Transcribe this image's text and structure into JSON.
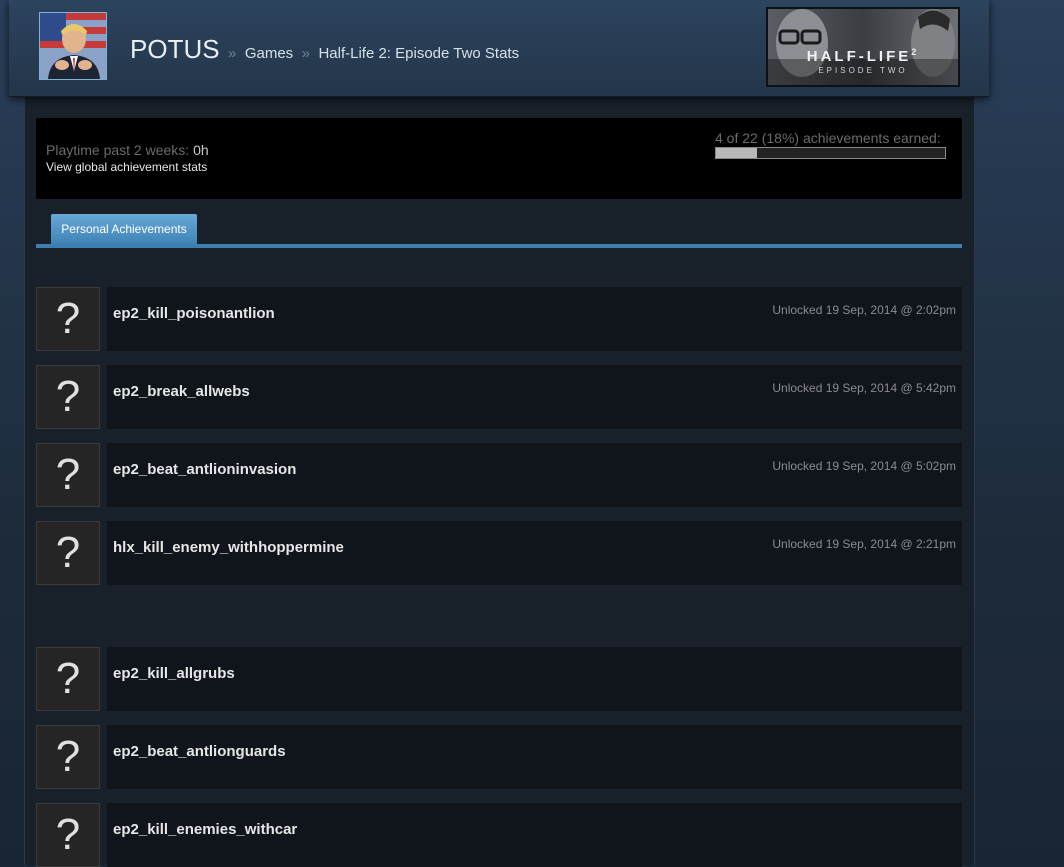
{
  "header": {
    "username": "POTUS",
    "sep": "»",
    "games_label": "Games",
    "game_stats_label": "Half-Life 2: Episode Two Stats",
    "game_logo_title": "HALF-LIFE",
    "game_logo_number": "2",
    "game_logo_subtitle": "EPISODE TWO"
  },
  "stats": {
    "playtime_label": "Playtime past 2 weeks:",
    "playtime_value": "0h",
    "global_link": "View global achievement stats",
    "achievements_summary": "4 of 22 (18%) achievements earned:",
    "progress_fraction": 0.18
  },
  "tabs": [
    {
      "label": "Personal Achievements"
    }
  ],
  "achievements": {
    "unlocked": [
      {
        "name": "ep2_kill_poisonantlion",
        "date": "Unlocked 19 Sep, 2014 @ 2:02pm",
        "icon": "question-mark-icon"
      },
      {
        "name": "ep2_break_allwebs",
        "date": "Unlocked 19 Sep, 2014 @ 5:42pm",
        "icon": "question-mark-icon"
      },
      {
        "name": "ep2_beat_antlioninvasion",
        "date": "Unlocked 19 Sep, 2014 @ 5:02pm",
        "icon": "question-mark-icon"
      },
      {
        "name": "hlx_kill_enemy_withhoppermine",
        "date": "Unlocked 19 Sep, 2014 @ 2:21pm",
        "icon": "question-mark-icon"
      }
    ],
    "locked": [
      {
        "name": "ep2_kill_allgrubs",
        "icon": "question-mark-icon"
      },
      {
        "name": "ep2_beat_antlionguards",
        "icon": "question-mark-icon"
      },
      {
        "name": "ep2_kill_enemies_withcar",
        "icon": "question-mark-icon"
      }
    ],
    "icon_glyph": "?"
  },
  "colors": {
    "accent": "#3d7fb0",
    "tab_active": "#4f96c8",
    "background": "#1b2838"
  }
}
